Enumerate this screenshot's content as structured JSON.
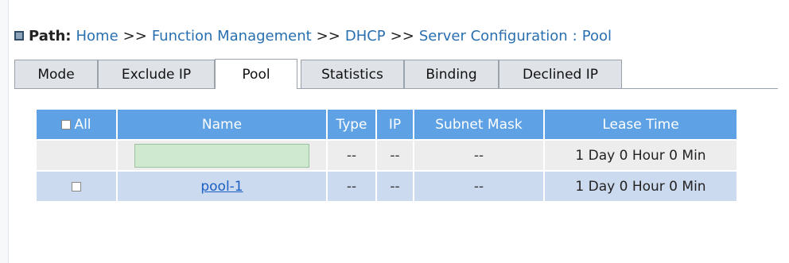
{
  "breadcrumb": {
    "label": "Path:",
    "items": [
      "Home",
      "Function Management",
      "DHCP",
      "Server Configuration"
    ],
    "separator": ">>",
    "current": "Pool"
  },
  "tabs": [
    {
      "label": "Mode",
      "active": false
    },
    {
      "label": "Exclude IP",
      "active": false
    },
    {
      "label": "Pool",
      "active": true
    },
    {
      "label": "Statistics",
      "active": false
    },
    {
      "label": "Binding",
      "active": false
    },
    {
      "label": "Declined IP",
      "active": false
    }
  ],
  "table": {
    "select_all_label": "All",
    "columns": [
      "Name",
      "Type",
      "IP",
      "Subnet Mask",
      "Lease Time"
    ],
    "new_row": {
      "name_value": "",
      "type": "--",
      "ip": "--",
      "subnet_mask": "--",
      "lease_time": "1 Day 0 Hour 0 Min"
    },
    "rows": [
      {
        "name": "pool-1",
        "type": "--",
        "ip": "--",
        "subnet_mask": "--",
        "lease_time": "1 Day 0 Hour 0 Min"
      }
    ]
  },
  "colors": {
    "header_bg": "#5ea1e4",
    "row_alt_bg": "#ccdaf0",
    "link": "#1a5fc4",
    "input_bg": "#cfe8d0"
  }
}
